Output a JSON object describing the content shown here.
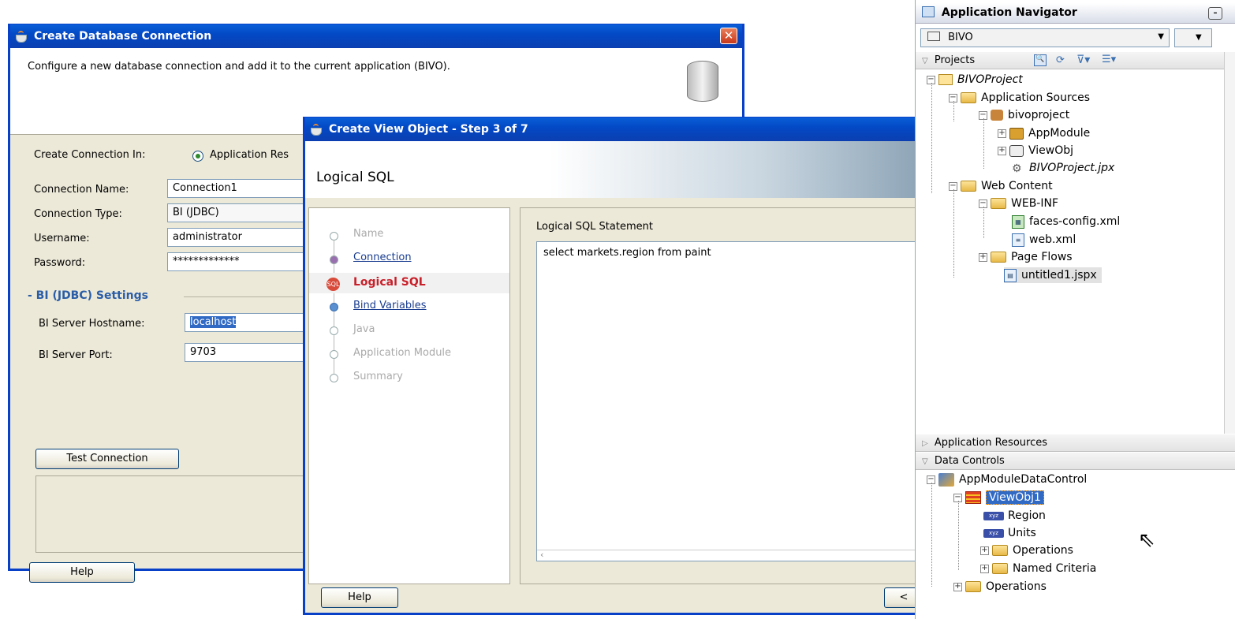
{
  "db_dialog": {
    "title": "Create Database Connection",
    "description": "Configure a new database connection and add it to the current application (BIVO).",
    "create_in_label": "Create Connection In:",
    "create_in_option": "Application Res",
    "conn_name_label": "Connection Name:",
    "conn_name_value": "Connection1",
    "conn_type_label": "Connection Type:",
    "conn_type_value": "BI (JDBC)",
    "username_label": "Username:",
    "username_value": "administrator",
    "password_label": "Password:",
    "password_value": "*************",
    "section_title": "- BI (JDBC) Settings",
    "hostname_label": "BI Server Hostname:",
    "hostname_value": "localhost",
    "port_label": "BI Server Port:",
    "port_value": "9703",
    "test_button": "Test Connection",
    "help_button": "Help"
  },
  "vo_dialog": {
    "title": "Create View Object - Step 3 of 7",
    "header": "Logical SQL",
    "steps": [
      "Name",
      "Connection",
      "Logical SQL",
      "Bind Variables",
      "Java",
      "Application Module",
      "Summary"
    ],
    "sql_label": "Logical SQL Statement",
    "sql_text": "select markets.region from paint",
    "help_button": "Help",
    "back_button": "<"
  },
  "navigator": {
    "title": "Application Navigator",
    "app_selector": "BIVO",
    "projects_label": "Projects",
    "tree": {
      "project": "BIVOProject",
      "app_sources": "Application Sources",
      "package": "bivoproject",
      "appmodule": "AppModule",
      "viewobj": "ViewObj",
      "jpx": "BIVOProject.jpx",
      "web_content": "Web Content",
      "web_inf": "WEB-INF",
      "faces_config": "faces-config.xml",
      "web_xml": "web.xml",
      "page_flows": "Page Flows",
      "untitled": "untitled1.jspx"
    },
    "app_resources_label": "Application Resources",
    "data_controls_label": "Data Controls",
    "dc_tree": {
      "control": "AppModuleDataControl",
      "viewobj1": "ViewObj1",
      "region": "Region",
      "units": "Units",
      "operations_inner": "Operations",
      "named_criteria": "Named Criteria",
      "operations": "Operations"
    }
  }
}
